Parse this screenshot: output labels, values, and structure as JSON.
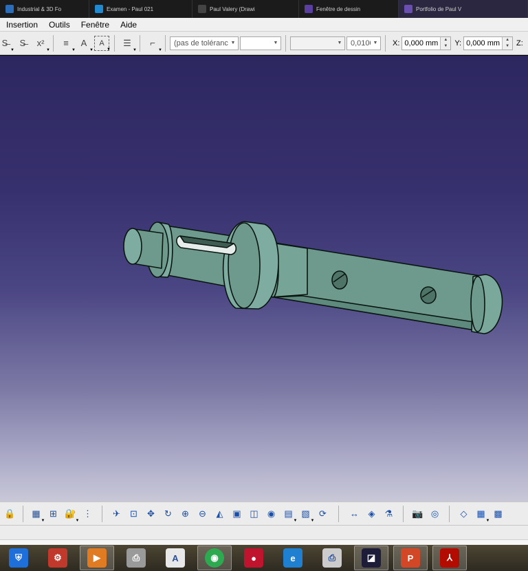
{
  "tabs": [
    {
      "label": "Industrial & 3D Fo",
      "color": "#2a6ebb"
    },
    {
      "label": "Examen - Paul 021",
      "color": "#1f8ad2"
    },
    {
      "label": "Paul Valery (Drawi",
      "color": "#444444"
    },
    {
      "label": "Fenêtre de dessin",
      "color": "#5a3fa0"
    },
    {
      "label": "Portfolio de Paul V",
      "color": "#6a4fb0"
    }
  ],
  "menu": {
    "insertion": "Insertion",
    "outils": "Outils",
    "fenetre": "Fenêtre",
    "aide": "Aide"
  },
  "toolbar": {
    "tolerance_combo": "(pas de toléranc",
    "value_combo": "0,0100",
    "x_label": "X:",
    "x_value": "0,000 mm",
    "y_label": "Y:",
    "y_value": "0,000 mm",
    "z_label": "Z:"
  },
  "icons": {
    "toolbar": [
      "strikethrough-icon",
      "strikethrough-icon",
      "superscript-icon",
      "align-icon",
      "text-frame-icon",
      "text-box-icon",
      "text-align-icon",
      "anchor-icon"
    ],
    "bottom_toolbar": [
      "padlock-icon",
      "table-icon",
      "tree-icon",
      "lock-icon",
      "hierarchy-icon",
      "fly-mode-icon",
      "fit-all-icon",
      "pan-icon",
      "rotate-icon",
      "zoom-in-icon",
      "zoom-out-icon",
      "normal-view-icon",
      "multi-view-icon",
      "iso-view-icon",
      "shading-icon",
      "hide-show-icon",
      "swap-visible-icon",
      "update-icon",
      "measure-icon",
      "inertia-icon",
      "apply-material-icon",
      "capture-icon",
      "render-icon",
      "3d-compass-icon",
      "grid-icon",
      "grid-snap-icon"
    ],
    "taskbar": [
      "shield-app-icon",
      "gear-app-icon",
      "media-player-icon",
      "printer-scanner-icon",
      "document-app-icon",
      "chrome-icon",
      "screen-recorder-icon",
      "internet-explorer-icon",
      "fax-icon",
      "catia-icon",
      "powerpoint-icon",
      "acrobat-icon"
    ]
  },
  "colors": {
    "viewport_top": "#2d2760",
    "viewport_bottom": "#c8c8d8",
    "part_fill": "#6d9a8c",
    "part_edge": "#0a1510"
  }
}
